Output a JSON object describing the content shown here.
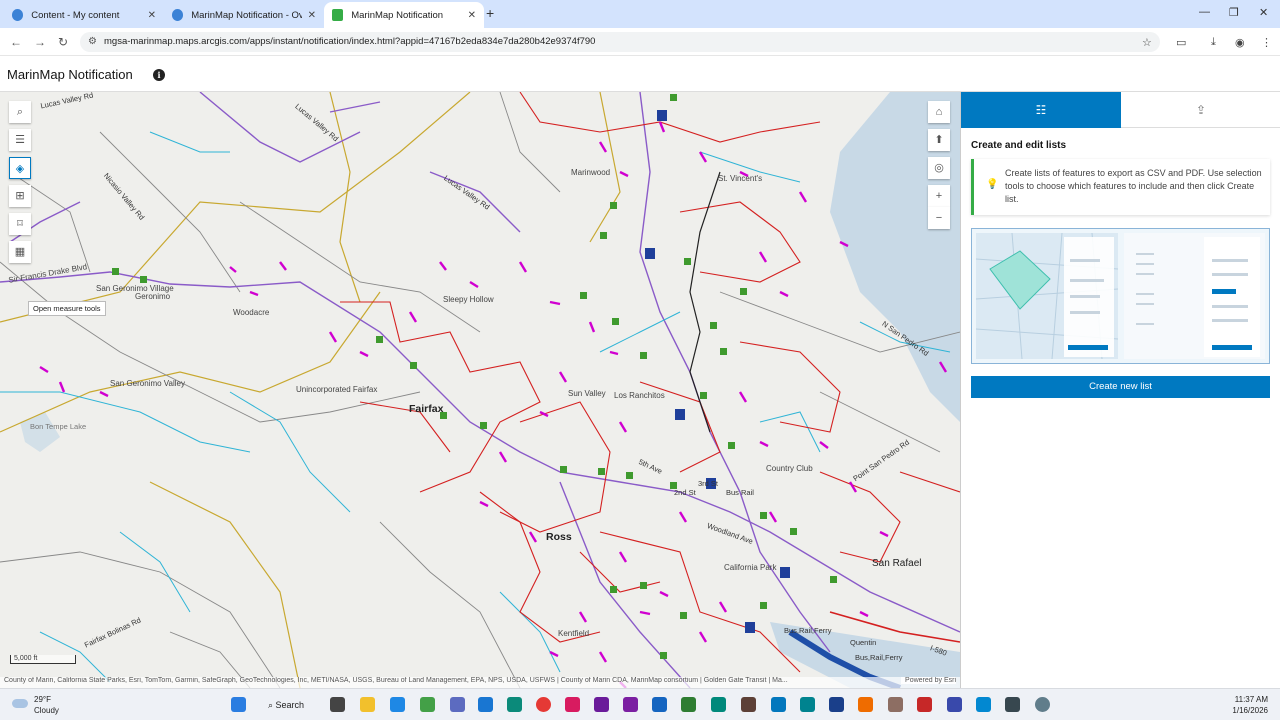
{
  "browser": {
    "tabs": [
      {
        "title": "Content - My content",
        "active": false
      },
      {
        "title": "MarinMap Notification - Overvi",
        "active": false
      },
      {
        "title": "MarinMap Notification",
        "active": true
      }
    ],
    "new_tab": "+",
    "url": "mgsa-marinmap.maps.arcgis.com/apps/instant/notification/index.html?appid=47167b2eda834e7da280b42e9374f790"
  },
  "app": {
    "title": "MarinMap Notification",
    "info_icon": "i"
  },
  "map": {
    "tooltip": "Open measure tools",
    "scale": "5,000 ft",
    "attribution": "County of Marin, California State Parks, Esri, TomTom, Garmin, SafeGraph, GeoTechnologies, Inc, METI/NASA, USGS, Bureau of Land Management, EPA, NPS, USDA, USFWS | County of Marin CDA, MarinMap consortium | Golden Gate Transit | Ma...",
    "powered_by": "Powered by Esri",
    "labels": {
      "lucas_valley_rd_1": "Lucas Valley Rd",
      "lucas_valley_rd_2": "Lucas Valley Rd",
      "lucas_valley_rd_3": "Lucas Valley Rd",
      "nicasio_valley_rd": "Nicasio Valley Rd",
      "marinwood": "Marinwood",
      "st_vincents": "St. Vincent's",
      "san_geronimo_village": "San Geronimo Village",
      "geronimo": "Geronimo",
      "woodacre": "Woodacre",
      "sleepy_hollow": "Sleepy Hollow",
      "san_geronimo_valley": "San Geronimo Valley",
      "unincorporated_fairfax": "Unincorporated Fairfax",
      "fairfax": "Fairfax",
      "sun_valley": "Sun Valley",
      "los_ranchitos": "Los Ranchitos",
      "country_club": "Country Club",
      "ross": "Ross",
      "san_rafael": "San Rafael",
      "kentfield": "Kentfield",
      "california_park": "California Park",
      "n_san_pedro_rd": "N San Pedro Rd",
      "point_san_pedro_rd": "Point San Pedro Rd",
      "sir_francis_drake_blvd": "Sir Francis Drake Blvd",
      "fairfax_bolinas_rd": "Fairfax Bolinas Rd",
      "bon_tempe_lake": "Bon Tempe Lake",
      "i580": "I-580",
      "bus_rail": "Bus Rail",
      "bus_rail_ferry": "Bus,Rail,Ferry",
      "bus_rail_ferry_2": "Bus,Rail,Ferry",
      "quentin": "Quentin",
      "woodland_ave": "Woodland Ave",
      "second_st": "2nd St",
      "third_st": "3rd St",
      "fifth_ave": "5th Ave"
    }
  },
  "panel": {
    "tab_list_icon": "list-icon",
    "tab_export_icon": "export-icon",
    "title": "Create and edit lists",
    "notice": "Create lists of features to export as CSV and PDF. Use selection tools to choose which features to include and then click Create list.",
    "create_button": "Create new list"
  },
  "taskbar": {
    "temp": "29°F",
    "condition": "Cloudy",
    "search": "Search",
    "time": "11:37 AM",
    "date": "1/16/2026"
  },
  "colors": {
    "accent": "#0079c1",
    "parcel_magenta": "#d000d0",
    "boundary_red": "#d42020",
    "stream_cyan": "#2fb4d6",
    "road_purple": "#8a5bc8",
    "park_green": "#3f9a2e",
    "district_gold": "#c8a830"
  }
}
